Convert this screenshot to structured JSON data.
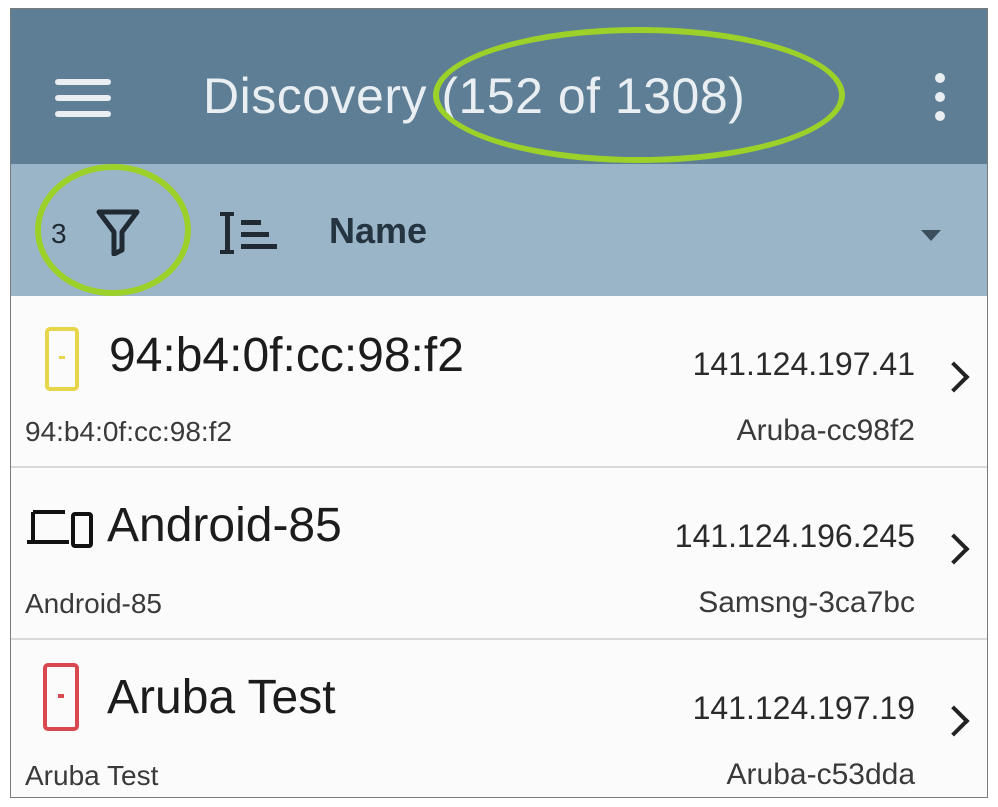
{
  "header": {
    "title": "Discovery (152 of 1308)",
    "menu_icon": "hamburger-menu-icon",
    "overflow_icon": "vertical-dots-icon"
  },
  "toolbar": {
    "filter_count": "3",
    "filter_icon": "filter-funnel-icon",
    "sort_icon": "sort-list-icon",
    "sort_field": "Name",
    "dropdown_icon": "caret-down-icon"
  },
  "devices": [
    {
      "name": "94:b4:0f:cc:98:f2",
      "ip": "141.124.197.41",
      "subtitle": "94:b4:0f:cc:98:f2",
      "detail": "Aruba-cc98f2",
      "icon": "access-point-icon",
      "icon_color": "#e8d64a"
    },
    {
      "name": "Android-85",
      "ip": "141.124.196.245",
      "subtitle": "Android-85",
      "detail": "Samsng-3ca7bc",
      "icon": "laptop-phone-icon",
      "icon_color": "#111111"
    },
    {
      "name": "Aruba Test",
      "ip": "141.124.197.19",
      "subtitle": "Aruba Test",
      "detail": "Aruba-c53dda",
      "icon": "access-point-icon",
      "icon_color": "#d9484f"
    }
  ],
  "colors": {
    "appbar": "#5d7e94",
    "toolbar": "#9ab4c8",
    "highlight": "#9cd12a"
  }
}
